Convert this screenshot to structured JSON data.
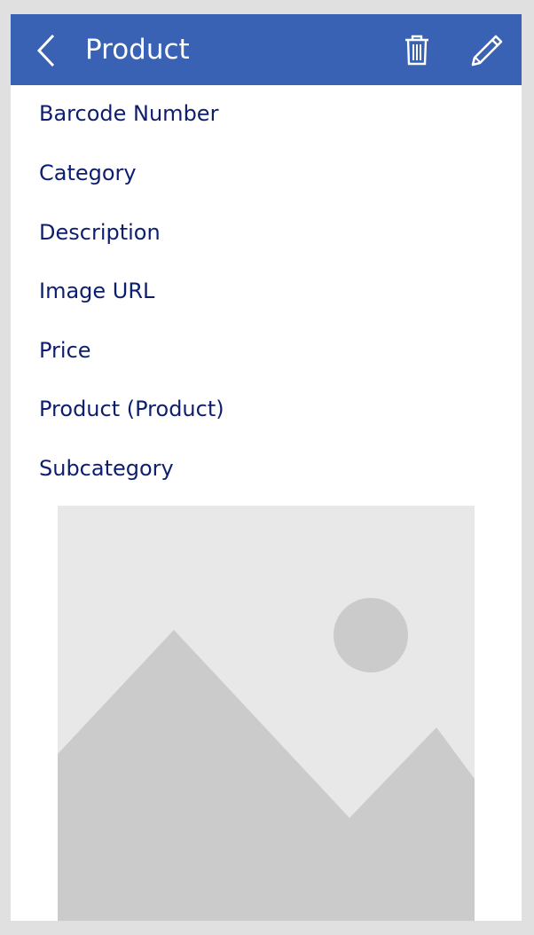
{
  "header": {
    "title": "Product",
    "back_icon": "chevron-left-icon",
    "delete_icon": "trash-icon",
    "edit_icon": "pencil-icon"
  },
  "fields": [
    {
      "label": "Barcode Number"
    },
    {
      "label": "Category"
    },
    {
      "label": "Description"
    },
    {
      "label": "Image URL"
    },
    {
      "label": "Price"
    },
    {
      "label": "Product (Product)"
    },
    {
      "label": "Subcategory"
    }
  ],
  "image": {
    "icon": "image-placeholder-icon"
  },
  "colors": {
    "header_bg": "#3961b4",
    "label_text": "#0e1e6e",
    "placeholder_bg": "#e8e8e8",
    "placeholder_shape": "#cbcbcb"
  }
}
